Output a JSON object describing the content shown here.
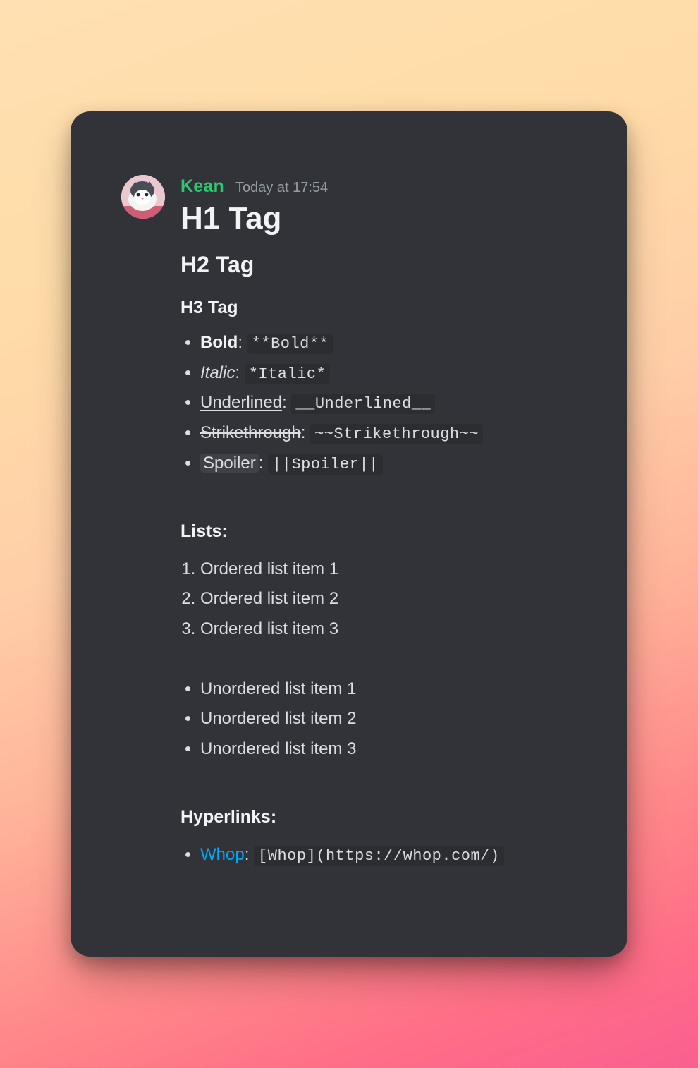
{
  "author": "Kean",
  "timestamp": "Today at 17:54",
  "headings": {
    "h1": "H1 Tag",
    "h2": "H2 Tag",
    "h3": "H3 Tag"
  },
  "formatting": [
    {
      "name": "bold",
      "display": "Bold",
      "code": "**Bold**",
      "css": "bold"
    },
    {
      "name": "italic",
      "display": "Italic",
      "code": "*Italic*",
      "css": "ital"
    },
    {
      "name": "underline",
      "display": "Underlined",
      "code": "__Underlined__",
      "css": "under"
    },
    {
      "name": "strike",
      "display": "Strikethrough",
      "code": "~~Strikethrough~~",
      "css": "strike"
    },
    {
      "name": "spoiler",
      "display": "Spoiler",
      "code": "||Spoiler||",
      "css": "spoil"
    }
  ],
  "lists_heading": "Lists:",
  "ordered": [
    "Ordered list item 1",
    "Ordered list item 2",
    "Ordered list item 3"
  ],
  "unordered": [
    "Unordered list item 1",
    "Unordered list item 2",
    "Unordered list item 3"
  ],
  "links_heading": "Hyperlinks:",
  "link": {
    "text": "Whop",
    "code": "[Whop](https://whop.com/)"
  },
  "colors": {
    "card_bg": "#313338",
    "author": "#2dc770",
    "link": "#00a8fc",
    "text": "#dbdee1"
  }
}
